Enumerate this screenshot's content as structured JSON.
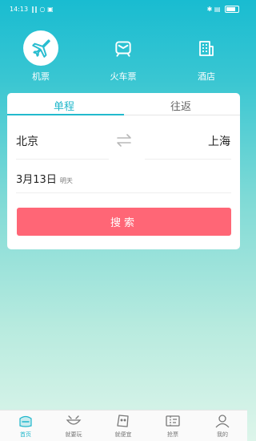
{
  "status": {
    "time": "14:13",
    "signal": "‖‖ ○ ▣",
    "right": "✱ ▤"
  },
  "nav": [
    {
      "label": "机票",
      "icon": "plane-icon",
      "active": true
    },
    {
      "label": "火车票",
      "icon": "train-icon",
      "active": false
    },
    {
      "label": "酒店",
      "icon": "hotel-icon",
      "active": false
    }
  ],
  "tabs": {
    "single": "单程",
    "round": "往返"
  },
  "trip": {
    "from": "北京",
    "to": "上海",
    "date": "3月13日",
    "date_note": "明天"
  },
  "search_label": "搜索",
  "bottom": [
    {
      "label": "首页",
      "icon": "home-icon"
    },
    {
      "label": "就要玩",
      "icon": "play-icon"
    },
    {
      "label": "就便宜",
      "icon": "deal-icon"
    },
    {
      "label": "抢票",
      "icon": "ticket-icon"
    },
    {
      "label": "我的",
      "icon": "user-icon"
    }
  ],
  "colors": {
    "accent": "#20b7cb",
    "search": "#ff6676"
  }
}
